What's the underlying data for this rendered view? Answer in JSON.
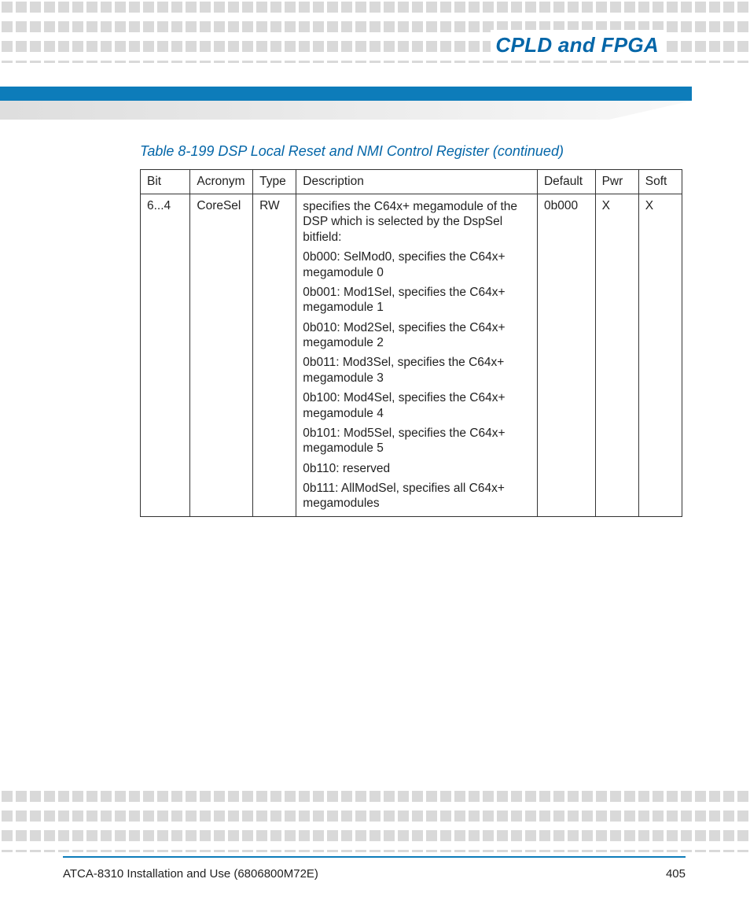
{
  "header": {
    "chapter_title": "CPLD and FPGA"
  },
  "table": {
    "caption": "Table 8-199 DSP Local Reset and NMI Control Register (continued)",
    "columns": [
      "Bit",
      "Acronym",
      "Type",
      "Description",
      "Default",
      "Pwr",
      "Soft"
    ],
    "row": {
      "bit": "6...4",
      "acronym": "CoreSel",
      "type": "RW",
      "default": "0b000",
      "pwr": "X",
      "soft": "X",
      "desc": [
        "specifies the C64x+ megamodule of the DSP which is selected by the DspSel bitfield:",
        "0b000: SelMod0, specifies the C64x+ megamodule 0",
        "0b001: Mod1Sel, specifies the C64x+ megamodule 1",
        "0b010: Mod2Sel, specifies the C64x+ megamodule 2",
        "0b011: Mod3Sel, specifies the C64x+ megamodule 3",
        "0b100: Mod4Sel, specifies the C64x+ megamodule 4",
        "0b101: Mod5Sel, specifies the C64x+ megamodule 5",
        "0b110: reserved",
        "0b111: AllModSel, specifies all C64x+ megamodules"
      ]
    }
  },
  "footer": {
    "doc_title": "ATCA-8310 Installation and Use (6806800M72E)",
    "page_number": "405"
  }
}
